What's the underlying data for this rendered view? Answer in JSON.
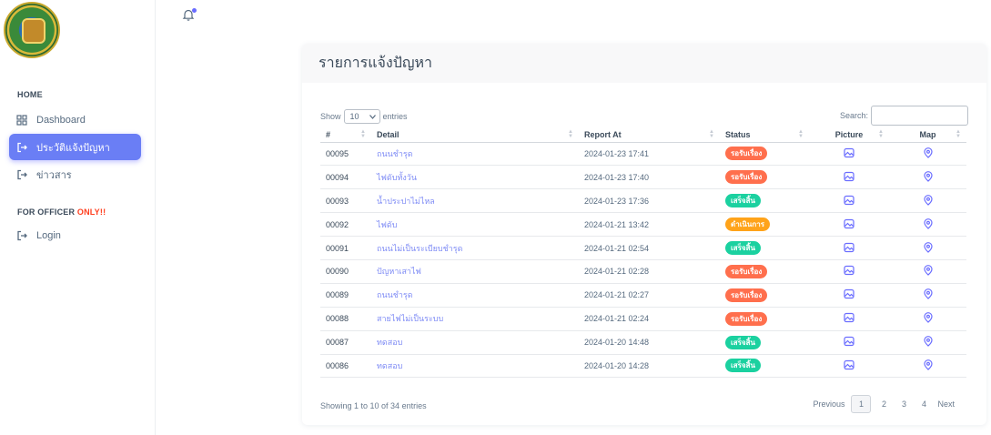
{
  "sidebar": {
    "section_home": "HOME",
    "section_officer": "FOR OFFICER",
    "section_officer_accent": "ONLY!!",
    "items": [
      {
        "label": "Dashboard",
        "icon": "grid-icon",
        "active": false
      },
      {
        "label": "ประวัติแจ้งปัญหา",
        "icon": "login-icon",
        "active": true
      },
      {
        "label": "ข่าวสาร",
        "icon": "login-icon",
        "active": false
      },
      {
        "label": "Login",
        "icon": "login-icon",
        "active": false
      }
    ]
  },
  "topbar": {
    "notification_icon": "bell-icon"
  },
  "card": {
    "title": "รายการแจ้งปัญหา",
    "show_label": "Show",
    "entries_value": "10",
    "entries_label": "entries",
    "search_label": "Search:",
    "search_value": "",
    "columns": [
      "#",
      "Detail",
      "Report At",
      "Status",
      "Picture",
      "Map"
    ],
    "rows": [
      {
        "id": "00095",
        "detail": "ถนนชำรุด",
        "report_at": "2024-01-23 17:41",
        "status": "รอรับเรื่อง"
      },
      {
        "id": "00094",
        "detail": "ไฟดับทั้งวัน",
        "report_at": "2024-01-23 17:40",
        "status": "รอรับเรื่อง"
      },
      {
        "id": "00093",
        "detail": "น้ำประปาไม่ไหล",
        "report_at": "2024-01-23 17:36",
        "status": "เสร็จสิ้น"
      },
      {
        "id": "00092",
        "detail": "ไฟดับ",
        "report_at": "2024-01-21 13:42",
        "status": "ดำเนินการ"
      },
      {
        "id": "00091",
        "detail": "ถนนไม่เป็นระเบียบชำรุด",
        "report_at": "2024-01-21 02:54",
        "status": "เสร็จสิ้น"
      },
      {
        "id": "00090",
        "detail": "ปัญหาเสาไฟ",
        "report_at": "2024-01-21 02:28",
        "status": "รอรับเรื่อง"
      },
      {
        "id": "00089",
        "detail": "ถนนชำรุด",
        "report_at": "2024-01-21 02:27",
        "status": "รอรับเรื่อง"
      },
      {
        "id": "00088",
        "detail": "สายไฟไม่เป็นระบบ",
        "report_at": "2024-01-21 02:24",
        "status": "รอรับเรื่อง"
      },
      {
        "id": "00087",
        "detail": "ทดสอบ",
        "report_at": "2024-01-20 14:48",
        "status": "เสร็จสิ้น"
      },
      {
        "id": "00086",
        "detail": "ทดสอบ",
        "report_at": "2024-01-20 14:28",
        "status": "เสร็จสิ้น"
      }
    ],
    "status_colors": {
      "รอรับเรื่อง": "#ff6f4d",
      "เสร็จสิ้น": "#1bd1a0",
      "ดำเนินการ": "#ffa31a"
    },
    "footer_info": "Showing 1 to 10 of 34 entries",
    "pager": {
      "previous": "Previous",
      "pages": [
        "1",
        "2",
        "3",
        "4"
      ],
      "current": "1",
      "next": "Next"
    }
  },
  "colors": {
    "accent": "#696cff",
    "link": "#7f8cf5"
  }
}
